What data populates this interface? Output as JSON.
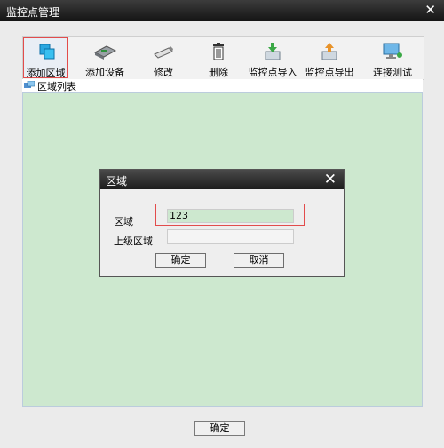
{
  "window": {
    "title": "监控点管理"
  },
  "toolbar": {
    "items": [
      {
        "label": "添加区域",
        "icon": "add-area-icon"
      },
      {
        "label": "添加设备",
        "icon": "add-device-icon"
      },
      {
        "label": "修改",
        "icon": "edit-icon"
      },
      {
        "label": "删除",
        "icon": "delete-icon"
      },
      {
        "label": "监控点导入",
        "icon": "import-icon"
      },
      {
        "label": "监控点导出",
        "icon": "export-icon"
      },
      {
        "label": "连接测试",
        "icon": "connection-test-icon"
      }
    ]
  },
  "list": {
    "header": "区域列表"
  },
  "dialog": {
    "title": "区域",
    "fields": {
      "area_label": "区域",
      "area_value": "123",
      "parent_label": "上级区域",
      "parent_value": ""
    },
    "ok_label": "确定",
    "cancel_label": "取消"
  },
  "footer": {
    "ok_label": "确定"
  },
  "colors": {
    "list_bg": "#cde8cf",
    "highlight": "#e24c4c",
    "titlebar": "#1c1c1c"
  }
}
